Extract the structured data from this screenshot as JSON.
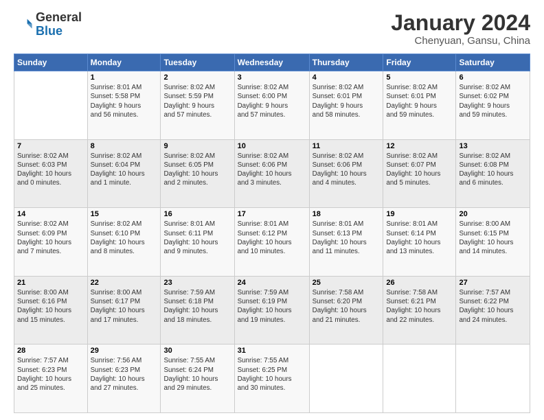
{
  "header": {
    "logo_general": "General",
    "logo_blue": "Blue",
    "month_title": "January 2024",
    "subtitle": "Chenyuan, Gansu, China"
  },
  "weekdays": [
    "Sunday",
    "Monday",
    "Tuesday",
    "Wednesday",
    "Thursday",
    "Friday",
    "Saturday"
  ],
  "weeks": [
    [
      {
        "day": "",
        "info": ""
      },
      {
        "day": "1",
        "info": "Sunrise: 8:01 AM\nSunset: 5:58 PM\nDaylight: 9 hours\nand 56 minutes."
      },
      {
        "day": "2",
        "info": "Sunrise: 8:02 AM\nSunset: 5:59 PM\nDaylight: 9 hours\nand 57 minutes."
      },
      {
        "day": "3",
        "info": "Sunrise: 8:02 AM\nSunset: 6:00 PM\nDaylight: 9 hours\nand 57 minutes."
      },
      {
        "day": "4",
        "info": "Sunrise: 8:02 AM\nSunset: 6:01 PM\nDaylight: 9 hours\nand 58 minutes."
      },
      {
        "day": "5",
        "info": "Sunrise: 8:02 AM\nSunset: 6:01 PM\nDaylight: 9 hours\nand 59 minutes."
      },
      {
        "day": "6",
        "info": "Sunrise: 8:02 AM\nSunset: 6:02 PM\nDaylight: 9 hours\nand 59 minutes."
      }
    ],
    [
      {
        "day": "7",
        "info": "Sunrise: 8:02 AM\nSunset: 6:03 PM\nDaylight: 10 hours\nand 0 minutes."
      },
      {
        "day": "8",
        "info": "Sunrise: 8:02 AM\nSunset: 6:04 PM\nDaylight: 10 hours\nand 1 minute."
      },
      {
        "day": "9",
        "info": "Sunrise: 8:02 AM\nSunset: 6:05 PM\nDaylight: 10 hours\nand 2 minutes."
      },
      {
        "day": "10",
        "info": "Sunrise: 8:02 AM\nSunset: 6:06 PM\nDaylight: 10 hours\nand 3 minutes."
      },
      {
        "day": "11",
        "info": "Sunrise: 8:02 AM\nSunset: 6:06 PM\nDaylight: 10 hours\nand 4 minutes."
      },
      {
        "day": "12",
        "info": "Sunrise: 8:02 AM\nSunset: 6:07 PM\nDaylight: 10 hours\nand 5 minutes."
      },
      {
        "day": "13",
        "info": "Sunrise: 8:02 AM\nSunset: 6:08 PM\nDaylight: 10 hours\nand 6 minutes."
      }
    ],
    [
      {
        "day": "14",
        "info": "Sunrise: 8:02 AM\nSunset: 6:09 PM\nDaylight: 10 hours\nand 7 minutes."
      },
      {
        "day": "15",
        "info": "Sunrise: 8:02 AM\nSunset: 6:10 PM\nDaylight: 10 hours\nand 8 minutes."
      },
      {
        "day": "16",
        "info": "Sunrise: 8:01 AM\nSunset: 6:11 PM\nDaylight: 10 hours\nand 9 minutes."
      },
      {
        "day": "17",
        "info": "Sunrise: 8:01 AM\nSunset: 6:12 PM\nDaylight: 10 hours\nand 10 minutes."
      },
      {
        "day": "18",
        "info": "Sunrise: 8:01 AM\nSunset: 6:13 PM\nDaylight: 10 hours\nand 11 minutes."
      },
      {
        "day": "19",
        "info": "Sunrise: 8:01 AM\nSunset: 6:14 PM\nDaylight: 10 hours\nand 13 minutes."
      },
      {
        "day": "20",
        "info": "Sunrise: 8:00 AM\nSunset: 6:15 PM\nDaylight: 10 hours\nand 14 minutes."
      }
    ],
    [
      {
        "day": "21",
        "info": "Sunrise: 8:00 AM\nSunset: 6:16 PM\nDaylight: 10 hours\nand 15 minutes."
      },
      {
        "day": "22",
        "info": "Sunrise: 8:00 AM\nSunset: 6:17 PM\nDaylight: 10 hours\nand 17 minutes."
      },
      {
        "day": "23",
        "info": "Sunrise: 7:59 AM\nSunset: 6:18 PM\nDaylight: 10 hours\nand 18 minutes."
      },
      {
        "day": "24",
        "info": "Sunrise: 7:59 AM\nSunset: 6:19 PM\nDaylight: 10 hours\nand 19 minutes."
      },
      {
        "day": "25",
        "info": "Sunrise: 7:58 AM\nSunset: 6:20 PM\nDaylight: 10 hours\nand 21 minutes."
      },
      {
        "day": "26",
        "info": "Sunrise: 7:58 AM\nSunset: 6:21 PM\nDaylight: 10 hours\nand 22 minutes."
      },
      {
        "day": "27",
        "info": "Sunrise: 7:57 AM\nSunset: 6:22 PM\nDaylight: 10 hours\nand 24 minutes."
      }
    ],
    [
      {
        "day": "28",
        "info": "Sunrise: 7:57 AM\nSunset: 6:23 PM\nDaylight: 10 hours\nand 25 minutes."
      },
      {
        "day": "29",
        "info": "Sunrise: 7:56 AM\nSunset: 6:23 PM\nDaylight: 10 hours\nand 27 minutes."
      },
      {
        "day": "30",
        "info": "Sunrise: 7:55 AM\nSunset: 6:24 PM\nDaylight: 10 hours\nand 29 minutes."
      },
      {
        "day": "31",
        "info": "Sunrise: 7:55 AM\nSunset: 6:25 PM\nDaylight: 10 hours\nand 30 minutes."
      },
      {
        "day": "",
        "info": ""
      },
      {
        "day": "",
        "info": ""
      },
      {
        "day": "",
        "info": ""
      }
    ]
  ]
}
